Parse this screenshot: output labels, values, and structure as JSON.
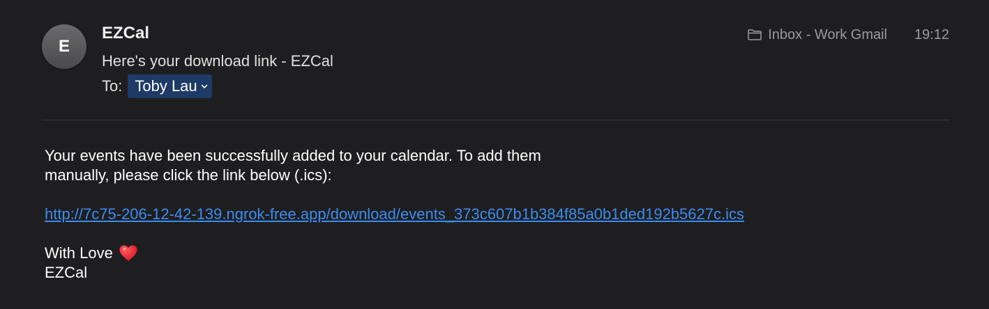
{
  "header": {
    "avatar_initial": "E",
    "sender": "EZCal",
    "subject": "Here's your download link - EZCal",
    "to_label": "To:",
    "recipient": "Toby Lau",
    "mailbox": "Inbox - Work Gmail",
    "time": "19:12"
  },
  "body": {
    "intro": "Your events have been successfully added to your calendar. To add them manually, please click the link below (.ics):",
    "link": "http://7c75-206-12-42-139.ngrok-free.app/download/events_373c607b1b384f85a0b1ded192b5627c.ics",
    "signoff": "With Love",
    "signature": "EZCal"
  },
  "icons": {
    "folder": "folder-icon",
    "chevron": "chevron-down-icon",
    "heart": "heart-icon"
  },
  "colors": {
    "background": "#1e1e20",
    "recipient_chip": "#1e3a66",
    "link": "#3b8cf0",
    "muted": "#9b9b9f",
    "heart": "#e8222f"
  }
}
